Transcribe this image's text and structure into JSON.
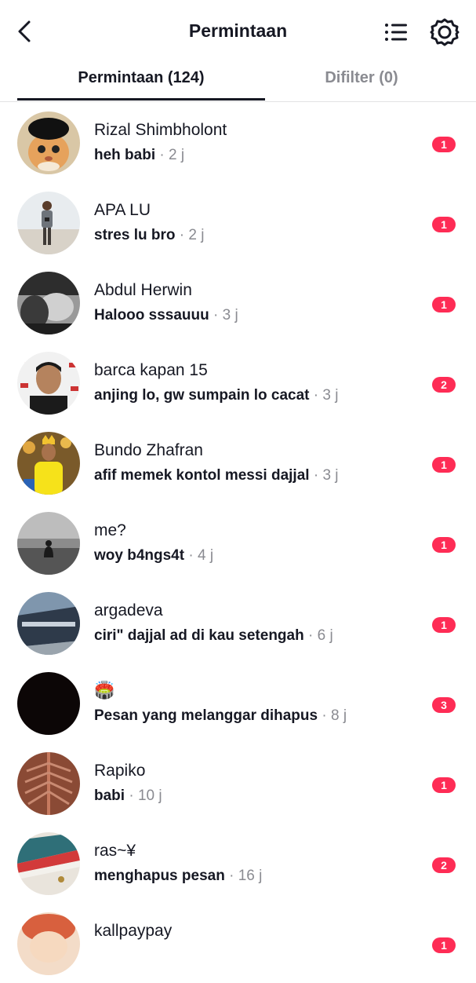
{
  "header": {
    "title": "Permintaan",
    "back_icon": "chevron-left-icon",
    "list_icon": "list-icon",
    "settings_icon": "gear-icon"
  },
  "tabs": [
    {
      "label": "Permintaan (124)",
      "active": true
    },
    {
      "label": "Difilter (0)",
      "active": false
    }
  ],
  "colors": {
    "badge": "#fe2c55",
    "muted": "#8a8b91",
    "text": "#161823"
  },
  "requests": [
    {
      "name": "Rizal Shimbholont",
      "message": "heh babi",
      "time": "2 j",
      "unread": "1"
    },
    {
      "name": "APA LU",
      "message": "stres lu bro",
      "time": "2 j",
      "unread": "1"
    },
    {
      "name": "Abdul Herwin",
      "message": "Halooo sssauuu",
      "time": "3 j",
      "unread": "1"
    },
    {
      "name": "barca kapan 15",
      "message": "anjing lo, gw sumpain lo cacat",
      "time": "3 j",
      "unread": "2"
    },
    {
      "name": "Bundo Zhafran",
      "message": "afif memek kontol messi dajjal",
      "time": "3 j",
      "unread": "1"
    },
    {
      "name": "me?",
      "message": "woy b4ngs4t",
      "time": "4 j",
      "unread": "1"
    },
    {
      "name": "argadeva",
      "message": "ciri\" dajjal ad di kau setengah",
      "time": "6 j",
      "unread": "1"
    },
    {
      "name": "🏟️",
      "message": "Pesan yang melanggar dihapus",
      "time": "8 j",
      "unread": "3"
    },
    {
      "name": "Rapiko",
      "message": "babi",
      "time": "10 j",
      "unread": "1"
    },
    {
      "name": "ras~¥",
      "message": "menghapus pesan",
      "time": "16 j",
      "unread": "2"
    },
    {
      "name": "kallpaypay",
      "message": "",
      "time": "",
      "unread": "1"
    }
  ]
}
